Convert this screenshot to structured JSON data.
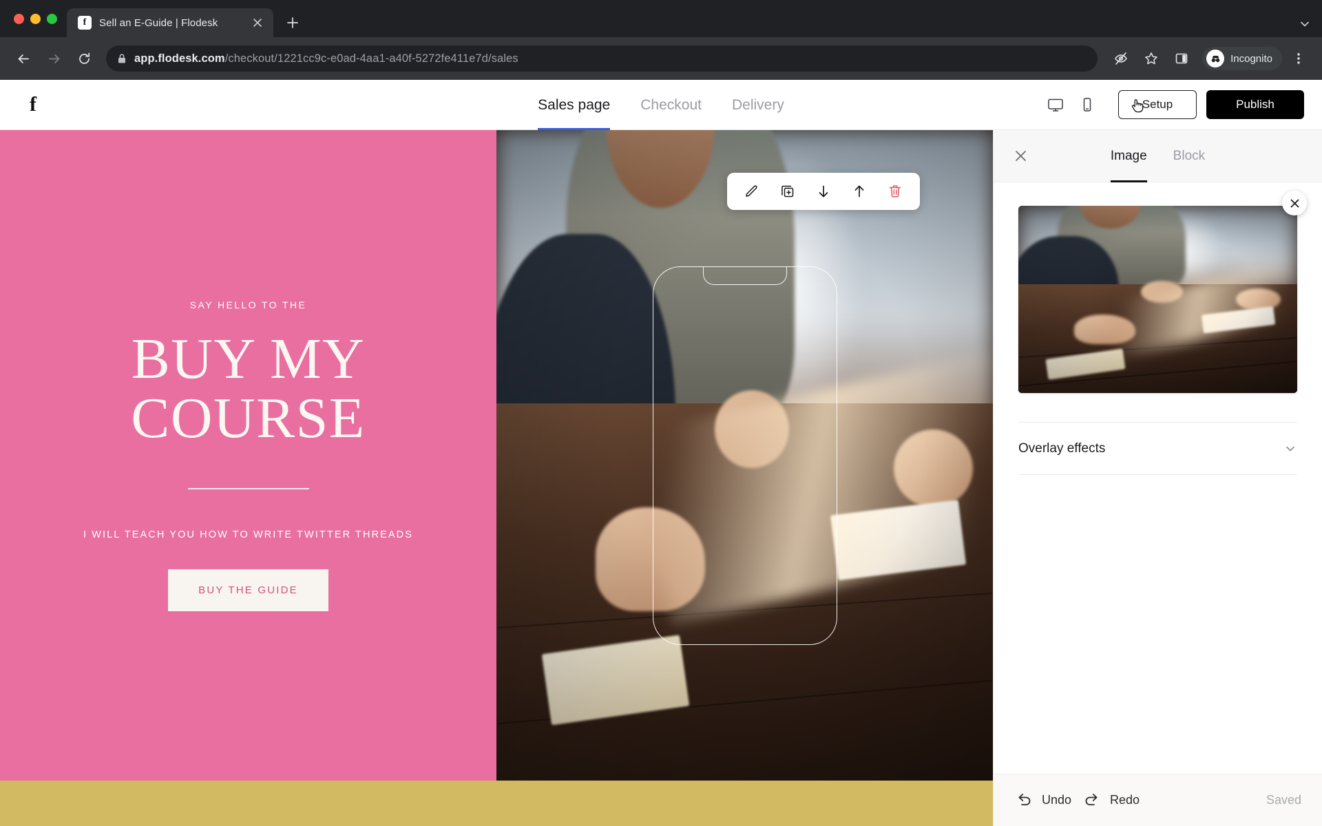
{
  "browser": {
    "tab": {
      "title": "Sell an E-Guide | Flodesk",
      "favicon_icon": "flodesk-f-icon",
      "close_icon": "close-icon"
    },
    "new_tab_icon": "plus-icon",
    "tablist_chevron_icon": "chevron-down-icon",
    "back_icon": "back-arrow-icon",
    "forward_icon": "forward-arrow-icon",
    "reload_icon": "reload-icon",
    "lock_icon": "lock-icon",
    "url": {
      "host": "app.flodesk.com",
      "path": "/checkout/1221cc9c-e0ad-4aa1-a40f-5272fe411e7d/sales"
    },
    "actions": {
      "tracking_protection_icon": "eye-slash-icon",
      "bookmark_icon": "star-icon",
      "side_panel_icon": "side-panel-icon",
      "profile_icon": "incognito-avatar-icon",
      "profile_label": "Incognito",
      "menu_icon": "three-dot-menu-icon"
    }
  },
  "app": {
    "logo_icon": "flodesk-logo-icon",
    "tabs": [
      {
        "label": "Sales page",
        "active": true
      },
      {
        "label": "Checkout",
        "active": false
      },
      {
        "label": "Delivery",
        "active": false
      }
    ],
    "view_toggle": [
      {
        "icon": "desktop-view-icon",
        "label": "Desktop"
      },
      {
        "icon": "mobile-view-icon",
        "label": "Mobile"
      }
    ],
    "setup_label": "Setup",
    "publish_label": "Publish",
    "cursor_icon": "pointing-hand-cursor-icon"
  },
  "hero": {
    "eyebrow": "SAY HELLO TO THE",
    "title_line1": "BUY MY",
    "title_line2": "COURSE",
    "subheading": "I WILL TEACH YOU HOW TO WRITE TWITTER THREADS",
    "cta_label": "BUY THE GUIDE",
    "background_color": "#e86fa0",
    "cta_background": "#f8f4ef",
    "cta_text_color": "#d0537f",
    "strip_color": "#d2ba62"
  },
  "image_toolbar": [
    {
      "icon": "pencil-edit-icon",
      "label": "Edit"
    },
    {
      "icon": "duplicate-block-icon",
      "label": "Duplicate"
    },
    {
      "icon": "move-down-icon",
      "label": "Move down"
    },
    {
      "icon": "move-up-icon",
      "label": "Move up"
    },
    {
      "icon": "trash-delete-icon",
      "label": "Delete"
    }
  ],
  "panel": {
    "close_icon": "close-icon",
    "tabs": [
      {
        "label": "Image",
        "active": true
      },
      {
        "label": "Block",
        "active": false
      }
    ],
    "thumbnail": {
      "remove_icon": "close-icon",
      "alt": "People writing at a wooden table"
    },
    "overlay_effects": {
      "label": "Overlay effects",
      "chevron_icon": "chevron-down-icon"
    },
    "footer": {
      "undo_icon": "undo-arrow-icon",
      "undo_label": "Undo",
      "redo_icon": "redo-arrow-icon",
      "redo_label": "Redo",
      "status": "Saved"
    }
  }
}
